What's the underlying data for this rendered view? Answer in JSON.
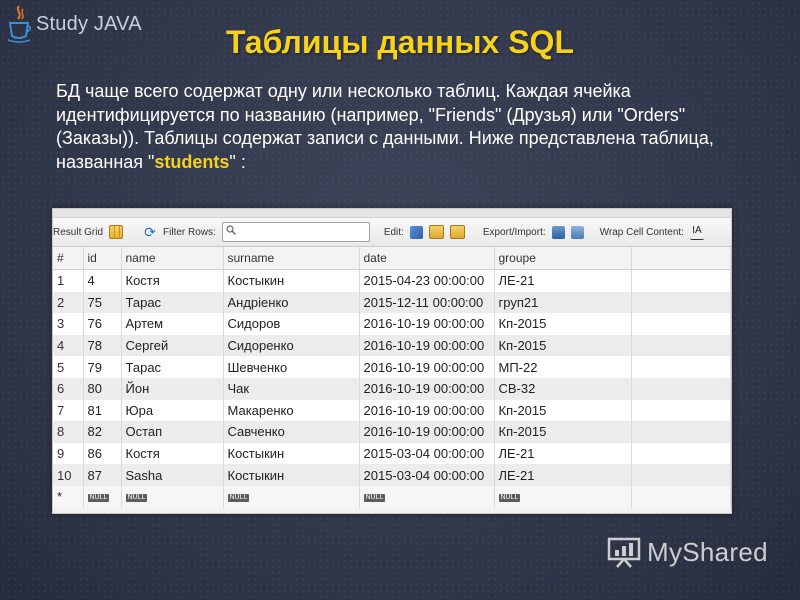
{
  "logo": {
    "prefix": "Study",
    "suffix": "JAVA"
  },
  "slide": {
    "title": "Таблицы данных SQL",
    "paragraph_before": "БД чаще всего содержат одну или несколько таблиц. Каждая ячейка идентифицируется по названию (например, \"Friends\" (Друзья) или \"Orders\" (Заказы)). Таблицы содержат записи с данными. Ниже представлена таблица, названная \"",
    "highlight": "students",
    "paragraph_after": "\" :"
  },
  "toolbar": {
    "result_grid": "Result Grid",
    "filter_rows": "Filter Rows:",
    "edit": "Edit:",
    "export_import": "Export/Import:",
    "wrap_cell": "Wrap Cell Content:"
  },
  "table": {
    "columns": [
      "#",
      "id",
      "name",
      "surname",
      "date",
      "groupe"
    ],
    "rows": [
      [
        "1",
        "4",
        "Костя",
        "Костыкин",
        "2015-04-23 00:00:00",
        "ЛЕ-21"
      ],
      [
        "2",
        "75",
        "Тарас",
        "Андріенко",
        "2015-12-11 00:00:00",
        "груп21"
      ],
      [
        "3",
        "76",
        "Артем",
        "Сидоров",
        "2016-10-19 00:00:00",
        "Кп-2015"
      ],
      [
        "4",
        "78",
        "Сергей",
        "Сидоренко",
        "2016-10-19 00:00:00",
        "Кп-2015"
      ],
      [
        "5",
        "79",
        "Тарас",
        "Шевченко",
        "2016-10-19 00:00:00",
        "МП-22"
      ],
      [
        "6",
        "80",
        "Йон",
        "Чак",
        "2016-10-19 00:00:00",
        "СВ-32"
      ],
      [
        "7",
        "81",
        "Юра",
        "Макаренко",
        "2016-10-19 00:00:00",
        "Кп-2015"
      ],
      [
        "8",
        "82",
        "Остап",
        "Савченко",
        "2016-10-19 00:00:00",
        "Кп-2015"
      ],
      [
        "9",
        "86",
        "Костя",
        "Костыкин",
        "2015-03-04 00:00:00",
        "ЛЕ-21"
      ],
      [
        "10",
        "87",
        "Sasha",
        "Костыкин",
        "2015-03-04 00:00:00",
        "ЛЕ-21"
      ]
    ],
    "new_row_marker": "*",
    "null_label": "NULL"
  },
  "watermark": {
    "text": "MyShared"
  }
}
